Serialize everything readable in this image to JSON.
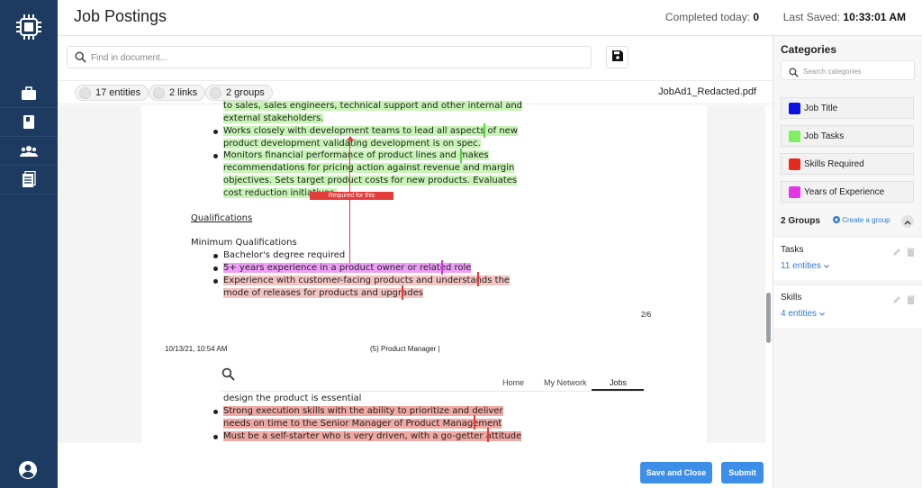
{
  "header": {
    "title": "Job Postings",
    "completed_label": "Completed today:",
    "completed_value": "0",
    "saved_label": "Last Saved:",
    "saved_value": "10:33:01 AM"
  },
  "search": {
    "placeholder": "Find in document..."
  },
  "chips": {
    "entities": "17 entities",
    "links": "2 links",
    "groups": "2 groups"
  },
  "filename": "JobAd1_Redacted.pdf",
  "document": {
    "lines_green": [
      "to sales, sales engineers, technical support and other internal and",
      "external stakeholders.",
      "Works closely with development teams to lead all aspects of new",
      "product development validating development is on spec.",
      "Monitors financial performance of product lines and makes",
      "recommendations for pricing action against revenue and margin",
      "objectives. Sets target product costs for new products. Evaluates",
      "cost reduction initiatives."
    ],
    "link_label": "Required for this",
    "qualifications_heading": "Qualifications",
    "min_quals_heading": "Minimum Qualifications",
    "bachelor": "Bachelor's degree required",
    "years_exp": "5+ years experience in a product owner or related role",
    "customer_exp_1": "Experience with customer-facing products and understands the",
    "customer_exp_2": "mode of releases for products and upgrades",
    "page_number": "2/6",
    "footer_date": "10/13/21, 10:54 AM",
    "footer_title": "(5) Product Manager |",
    "mini_tabs": [
      "Home",
      "My Network",
      "Jobs"
    ],
    "page3_line1": "design the product is essential",
    "page3_red_1": "Strong execution skills with the ability to prioritize and deliver",
    "page3_red_2": "needs on time to the Senior Manager of Product Management",
    "page3_red_3": "Must be a self-starter who is very driven, with a go-getter attitude"
  },
  "buttons": {
    "save_close": "Save and Close",
    "submit": "Submit"
  },
  "categories": {
    "title": "Categories",
    "search_placeholder": "Search categories",
    "items": [
      {
        "label": "Job Title",
        "color": "#0a10e6"
      },
      {
        "label": "Job Tasks",
        "color": "#7ef25e"
      },
      {
        "label": "Skills Required",
        "color": "#e8291d"
      },
      {
        "label": "Years of Experience",
        "color": "#e635e8"
      }
    ]
  },
  "groups": {
    "heading": "2 Groups",
    "create_label": "Create a group",
    "items": [
      {
        "name": "Tasks",
        "count": "11 entities"
      },
      {
        "name": "Skills",
        "count": "4 entities"
      }
    ]
  },
  "colors": {
    "nav": "#1d3a60",
    "accent": "#3c8ee8",
    "link": "#2d7bd6"
  }
}
